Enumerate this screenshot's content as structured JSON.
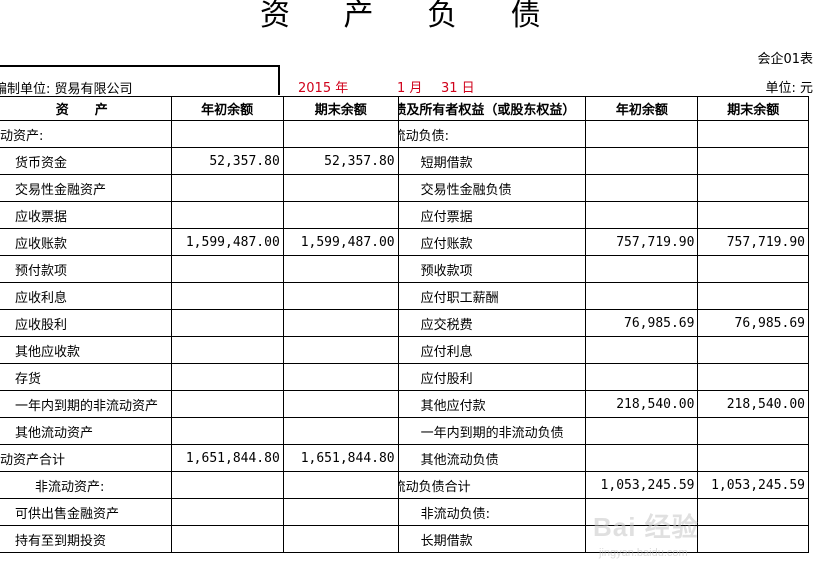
{
  "title": "资 产 负 债 表",
  "form_no": "会企01表",
  "org_label": "编制单位: 贸易有限公司",
  "date": {
    "year": "2015 年",
    "month": "1 月",
    "day": "31 日"
  },
  "unit": "单位: 元",
  "headers": [
    "资　　产",
    "年初余额",
    "期末余额",
    "负债及所有者权益（或股东权益）",
    "年初余额",
    "期末余额"
  ],
  "rows": [
    {
      "a": "流动资产:",
      "b": "",
      "c": "",
      "d": "流动负债:",
      "e": "",
      "f": ""
    },
    {
      "a": "货币资金",
      "b": "52,357.80",
      "c": "52,357.80",
      "d": "短期借款",
      "e": "",
      "f": ""
    },
    {
      "a": "交易性金融资产",
      "b": "",
      "c": "",
      "d": "交易性金融负债",
      "e": "",
      "f": ""
    },
    {
      "a": "应收票据",
      "b": "",
      "c": "",
      "d": "应付票据",
      "e": "",
      "f": ""
    },
    {
      "a": "应收账款",
      "b": "1,599,487.00",
      "c": "1,599,487.00",
      "d": "应付账款",
      "e": "757,719.90",
      "f": "757,719.90"
    },
    {
      "a": "预付款项",
      "b": "",
      "c": "",
      "d": "预收款项",
      "e": "",
      "f": ""
    },
    {
      "a": "应收利息",
      "b": "",
      "c": "",
      "d": "应付职工薪酬",
      "e": "",
      "f": ""
    },
    {
      "a": "应收股利",
      "b": "",
      "c": "",
      "d": "应交税费",
      "e": "76,985.69",
      "f": "76,985.69"
    },
    {
      "a": "其他应收款",
      "b": "",
      "c": "",
      "d": "应付利息",
      "e": "",
      "f": ""
    },
    {
      "a": "存货",
      "b": "",
      "c": "",
      "d": "应付股利",
      "e": "",
      "f": ""
    },
    {
      "a": "一年内到期的非流动资产",
      "b": "",
      "c": "",
      "d": "其他应付款",
      "e": "218,540.00",
      "f": "218,540.00"
    },
    {
      "a": "其他流动资产",
      "b": "",
      "c": "",
      "d": "一年内到期的非流动负债",
      "e": "",
      "f": ""
    },
    {
      "a": "流动资产合计",
      "b": "1,651,844.80",
      "c": "1,651,844.80",
      "d": "其他流动负债",
      "e": "",
      "f": ""
    },
    {
      "a": "非流动资产:",
      "b": "",
      "c": "",
      "d": "流动负债合计",
      "e": "1,053,245.59",
      "f": "1,053,245.59"
    },
    {
      "a": "可供出售金融资产",
      "b": "",
      "c": "",
      "d": "非流动负债:",
      "e": "",
      "f": ""
    },
    {
      "a": "持有至到期投资",
      "b": "",
      "c": "",
      "d": "长期借款",
      "e": "",
      "f": ""
    }
  ],
  "watermark": {
    "main": "Bai 经验",
    "sub": "jingyan.baidu.com"
  }
}
